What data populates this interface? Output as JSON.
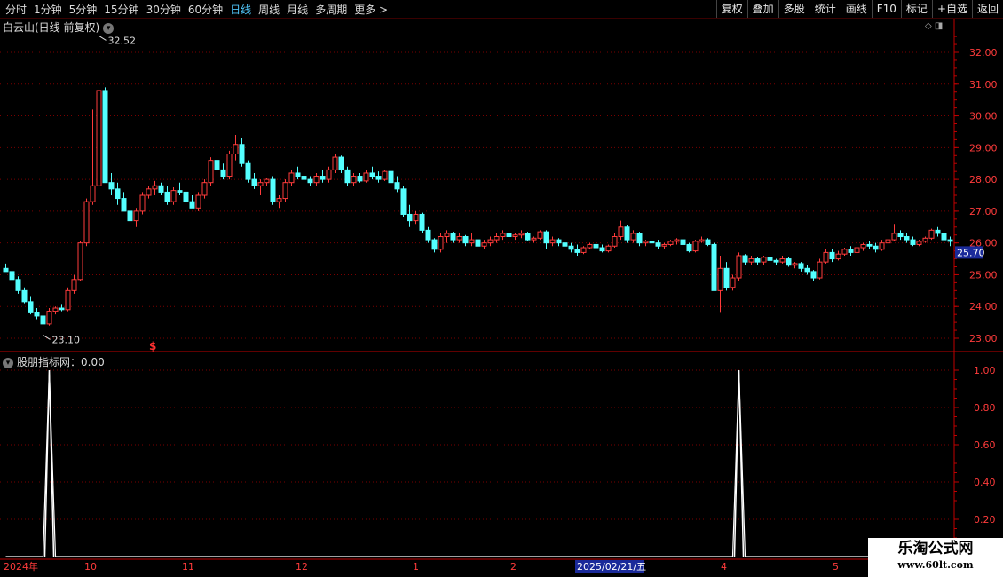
{
  "toolbar": {
    "periods": [
      "分时",
      "1分钟",
      "5分钟",
      "15分钟",
      "30分钟",
      "60分钟",
      "日线",
      "周线",
      "月线",
      "多周期",
      "更多 >"
    ],
    "active_period": "日线",
    "tools": [
      "复权",
      "叠加",
      "多股",
      "统计",
      "画线",
      "F10",
      "标记",
      "+自选",
      "返回"
    ]
  },
  "main_chart": {
    "title": "白云山(日线 前复权)",
    "dropdown_icon": "chevron-down-icon",
    "high_label": "32.52",
    "low_label": "23.10",
    "current_price": "25.70",
    "y_ticks": [
      "32.00",
      "31.00",
      "30.00",
      "29.00",
      "28.00",
      "27.00",
      "26.00",
      "25.00",
      "24.00",
      "23.00"
    ],
    "marker": "$"
  },
  "indicator": {
    "title": "股朋指标网：0.00",
    "y_ticks": [
      "1.00",
      "0.80",
      "0.60",
      "0.40",
      "0.20"
    ]
  },
  "x_axis": {
    "labels": [
      "2024年",
      "10",
      "11",
      "12",
      "1",
      "2",
      "4",
      "5"
    ],
    "highlight": "2025/02/21/五"
  },
  "watermark": {
    "line1": "乐淘公式网",
    "line2": "www.60lt.com"
  },
  "colors": {
    "up": "#ff3b3b",
    "down": "#54ffff",
    "grid": "#7a0000",
    "axis": "#c00000",
    "active": "#4fc3f7"
  },
  "chart_data": {
    "type": "candlestick",
    "series": [
      {
        "points": [
          [
            25.2,
            25.35,
            25.1,
            25.1
          ],
          [
            25.1,
            25.15,
            24.7,
            24.85
          ],
          [
            24.85,
            24.95,
            24.4,
            24.5
          ],
          [
            24.5,
            24.6,
            24.1,
            24.15
          ],
          [
            24.15,
            24.3,
            23.75,
            23.8
          ],
          [
            23.8,
            23.95,
            23.6,
            23.7
          ],
          [
            23.7,
            23.8,
            23.1,
            23.45
          ],
          [
            23.45,
            23.95,
            23.4,
            23.85
          ],
          [
            23.85,
            24.0,
            23.75,
            23.95
          ],
          [
            23.95,
            24.05,
            23.85,
            23.9
          ],
          [
            23.9,
            24.6,
            23.85,
            24.5
          ],
          [
            24.5,
            25.0,
            24.4,
            24.85
          ],
          [
            24.85,
            26.05,
            24.8,
            26.0
          ],
          [
            26.0,
            27.4,
            25.9,
            27.3
          ],
          [
            27.3,
            30.2,
            27.2,
            27.8
          ],
          [
            27.8,
            32.52,
            27.7,
            30.8
          ],
          [
            30.8,
            30.9,
            28.0,
            27.9
          ],
          [
            27.9,
            28.2,
            27.5,
            27.7
          ],
          [
            27.7,
            27.9,
            27.2,
            27.4
          ],
          [
            27.4,
            27.6,
            27.0,
            27.0
          ],
          [
            27.0,
            27.1,
            26.6,
            26.7
          ],
          [
            26.7,
            27.1,
            26.5,
            27.0
          ],
          [
            27.0,
            27.6,
            26.9,
            27.5
          ],
          [
            27.5,
            27.8,
            27.4,
            27.7
          ],
          [
            27.7,
            27.95,
            27.5,
            27.8
          ],
          [
            27.8,
            27.9,
            27.5,
            27.6
          ],
          [
            27.6,
            27.8,
            27.2,
            27.3
          ],
          [
            27.3,
            27.75,
            27.2,
            27.65
          ],
          [
            27.65,
            27.9,
            27.5,
            27.6
          ],
          [
            27.6,
            27.7,
            27.2,
            27.3
          ],
          [
            27.3,
            27.5,
            27.1,
            27.1
          ],
          [
            27.1,
            27.6,
            27.0,
            27.5
          ],
          [
            27.5,
            28.0,
            27.4,
            27.9
          ],
          [
            27.9,
            28.7,
            27.8,
            28.6
          ],
          [
            28.6,
            29.2,
            28.2,
            28.3
          ],
          [
            28.3,
            28.5,
            28.0,
            28.1
          ],
          [
            28.1,
            28.9,
            28.0,
            28.8
          ],
          [
            28.8,
            29.4,
            28.6,
            29.1
          ],
          [
            29.1,
            29.3,
            28.4,
            28.5
          ],
          [
            28.5,
            28.6,
            27.9,
            28.0
          ],
          [
            28.0,
            28.2,
            27.7,
            27.8
          ],
          [
            27.8,
            28.0,
            27.5,
            27.9
          ],
          [
            27.9,
            28.05,
            27.8,
            28.0
          ],
          [
            28.0,
            28.1,
            27.2,
            27.3
          ],
          [
            27.3,
            27.5,
            27.1,
            27.4
          ],
          [
            27.4,
            28.0,
            27.3,
            27.9
          ],
          [
            27.9,
            28.3,
            27.8,
            28.2
          ],
          [
            28.2,
            28.4,
            28.0,
            28.1
          ],
          [
            28.1,
            28.3,
            27.9,
            28.0
          ],
          [
            28.0,
            28.1,
            27.8,
            27.9
          ],
          [
            27.9,
            28.2,
            27.8,
            28.1
          ],
          [
            28.1,
            28.3,
            27.9,
            28.0
          ],
          [
            28.0,
            28.4,
            27.9,
            28.3
          ],
          [
            28.3,
            28.8,
            28.2,
            28.7
          ],
          [
            28.7,
            28.75,
            28.2,
            28.3
          ],
          [
            28.3,
            28.4,
            27.8,
            27.9
          ],
          [
            27.9,
            28.2,
            27.8,
            28.1
          ],
          [
            28.1,
            28.2,
            27.9,
            27.95
          ],
          [
            27.95,
            28.3,
            27.9,
            28.2
          ],
          [
            28.2,
            28.4,
            28.0,
            28.1
          ],
          [
            28.1,
            28.25,
            27.9,
            28.0
          ],
          [
            28.0,
            28.3,
            27.95,
            28.25
          ],
          [
            28.25,
            28.3,
            27.8,
            27.9
          ],
          [
            27.9,
            28.1,
            27.6,
            27.7
          ],
          [
            27.7,
            27.8,
            26.8,
            26.9
          ],
          [
            26.9,
            27.2,
            26.5,
            26.7
          ],
          [
            26.7,
            27.0,
            26.6,
            26.9
          ],
          [
            26.9,
            26.95,
            26.3,
            26.4
          ],
          [
            26.4,
            26.5,
            26.0,
            26.1
          ],
          [
            26.1,
            26.15,
            25.7,
            25.8
          ],
          [
            25.8,
            26.3,
            25.7,
            26.2
          ],
          [
            26.2,
            26.4,
            26.0,
            26.3
          ],
          [
            26.3,
            26.35,
            26.0,
            26.1
          ],
          [
            26.1,
            26.3,
            26.0,
            26.2
          ],
          [
            26.2,
            26.25,
            25.9,
            26.0
          ],
          [
            26.0,
            26.3,
            25.9,
            26.1
          ],
          [
            26.1,
            26.2,
            25.8,
            25.9
          ],
          [
            25.9,
            26.1,
            25.8,
            26.0
          ],
          [
            26.0,
            26.2,
            25.9,
            26.1
          ],
          [
            26.1,
            26.3,
            26.0,
            26.2
          ],
          [
            26.2,
            26.4,
            26.1,
            26.3
          ],
          [
            26.3,
            26.35,
            26.1,
            26.2
          ],
          [
            26.2,
            26.3,
            26.1,
            26.25
          ],
          [
            26.25,
            26.4,
            26.15,
            26.3
          ],
          [
            26.3,
            26.35,
            26.05,
            26.1
          ],
          [
            26.1,
            26.2,
            26.0,
            26.15
          ],
          [
            26.15,
            26.4,
            26.1,
            26.35
          ],
          [
            26.35,
            26.4,
            25.8,
            26.0
          ],
          [
            26.0,
            26.2,
            25.9,
            26.1
          ],
          [
            26.1,
            26.15,
            25.9,
            26.0
          ],
          [
            26.0,
            26.1,
            25.8,
            25.9
          ],
          [
            25.9,
            26.0,
            25.7,
            25.8
          ],
          [
            25.8,
            25.95,
            25.6,
            25.7
          ],
          [
            25.7,
            25.9,
            25.65,
            25.85
          ],
          [
            25.85,
            26.0,
            25.8,
            25.95
          ],
          [
            25.95,
            26.1,
            25.8,
            25.85
          ],
          [
            25.85,
            25.95,
            25.7,
            25.75
          ],
          [
            25.75,
            25.95,
            25.7,
            25.9
          ],
          [
            25.9,
            26.3,
            25.85,
            26.2
          ],
          [
            26.2,
            26.7,
            26.1,
            26.5
          ],
          [
            26.5,
            26.55,
            26.0,
            26.1
          ],
          [
            26.1,
            26.4,
            26.0,
            26.3
          ],
          [
            26.3,
            26.35,
            25.9,
            26.0
          ],
          [
            26.0,
            26.1,
            25.9,
            26.05
          ],
          [
            26.05,
            26.15,
            25.9,
            26.0
          ],
          [
            26.0,
            26.1,
            25.8,
            25.9
          ],
          [
            25.9,
            26.0,
            25.8,
            25.95
          ],
          [
            25.95,
            26.1,
            25.9,
            26.05
          ],
          [
            26.05,
            26.15,
            25.95,
            26.1
          ],
          [
            26.1,
            26.2,
            25.9,
            25.95
          ],
          [
            25.95,
            26.0,
            25.7,
            25.75
          ],
          [
            25.75,
            26.1,
            25.7,
            26.05
          ],
          [
            26.05,
            26.2,
            26.0,
            26.1
          ],
          [
            26.1,
            26.15,
            25.9,
            25.95
          ],
          [
            25.95,
            26.0,
            24.5,
            24.5
          ],
          [
            24.5,
            25.6,
            23.8,
            25.2
          ],
          [
            25.2,
            25.4,
            24.5,
            24.6
          ],
          [
            24.6,
            25.0,
            24.5,
            24.9
          ],
          [
            24.9,
            25.7,
            24.8,
            25.6
          ],
          [
            25.6,
            25.65,
            25.3,
            25.4
          ],
          [
            25.4,
            25.6,
            25.3,
            25.5
          ],
          [
            25.5,
            25.55,
            25.3,
            25.4
          ],
          [
            25.4,
            25.6,
            25.3,
            25.55
          ],
          [
            25.55,
            25.6,
            25.35,
            25.45
          ],
          [
            25.45,
            25.5,
            25.3,
            25.4
          ],
          [
            25.4,
            25.6,
            25.35,
            25.5
          ],
          [
            25.5,
            25.55,
            25.25,
            25.3
          ],
          [
            25.3,
            25.4,
            25.2,
            25.35
          ],
          [
            25.35,
            25.4,
            25.1,
            25.2
          ],
          [
            25.2,
            25.3,
            25.0,
            25.1
          ],
          [
            25.1,
            25.15,
            24.8,
            24.9
          ],
          [
            24.9,
            25.5,
            24.85,
            25.4
          ],
          [
            25.4,
            25.8,
            25.35,
            25.7
          ],
          [
            25.7,
            25.8,
            25.4,
            25.5
          ],
          [
            25.5,
            25.75,
            25.45,
            25.65
          ],
          [
            25.65,
            25.85,
            25.6,
            25.8
          ],
          [
            25.8,
            25.9,
            25.6,
            25.7
          ],
          [
            25.7,
            25.9,
            25.65,
            25.85
          ],
          [
            25.85,
            26.0,
            25.75,
            25.95
          ],
          [
            25.95,
            26.05,
            25.8,
            25.9
          ],
          [
            25.9,
            26.0,
            25.7,
            25.8
          ],
          [
            25.8,
            26.1,
            25.75,
            26.0
          ],
          [
            26.0,
            26.2,
            25.95,
            26.1
          ],
          [
            26.1,
            26.6,
            26.05,
            26.3
          ],
          [
            26.3,
            26.4,
            26.1,
            26.2
          ],
          [
            26.2,
            26.3,
            26.0,
            26.1
          ],
          [
            26.1,
            26.2,
            25.9,
            25.95
          ],
          [
            25.95,
            26.1,
            25.9,
            26.05
          ],
          [
            26.05,
            26.2,
            26.0,
            26.15
          ],
          [
            26.15,
            26.45,
            26.1,
            26.4
          ],
          [
            26.4,
            26.5,
            26.2,
            26.3
          ],
          [
            26.3,
            26.35,
            26.0,
            26.1
          ],
          [
            26.1,
            26.2,
            25.9,
            26.05
          ]
        ]
      },
      {
        "name": "股朋指标网",
        "values": [
          0,
          0,
          0,
          0,
          0,
          0,
          0,
          0,
          0,
          0,
          0,
          0,
          0,
          0,
          0,
          0,
          0,
          0,
          0,
          0,
          0,
          0,
          0,
          0,
          0,
          0,
          0,
          0,
          0,
          0,
          0,
          0,
          0,
          0,
          0,
          0,
          0,
          0,
          0,
          0,
          0,
          0,
          0,
          0,
          0,
          0,
          0,
          0,
          0,
          0,
          0,
          0,
          0,
          0,
          0,
          0,
          0,
          0,
          0,
          0,
          0,
          0,
          0,
          0,
          0,
          0,
          0,
          0,
          0,
          0,
          0,
          0,
          0,
          0,
          0,
          0,
          0,
          0,
          0,
          0,
          0,
          0,
          0,
          0,
          0,
          0,
          0,
          0,
          0,
          0,
          0,
          0,
          0,
          0,
          0,
          0,
          0,
          0,
          0,
          0,
          0,
          0,
          0,
          0,
          0,
          0,
          0,
          0,
          0,
          0,
          0,
          0,
          0,
          0,
          0,
          0,
          0,
          0,
          0,
          0,
          0,
          0,
          0,
          0,
          0,
          0,
          0,
          0,
          0,
          0,
          0,
          0,
          0,
          0,
          0,
          0,
          0,
          0,
          0,
          0,
          0,
          0,
          0,
          0,
          0,
          0,
          0,
          0,
          0,
          0,
          0,
          0,
          0,
          0,
          0,
          0,
          0
        ]
      }
    ],
    "spikes_at": [
      7,
      118
    ],
    "ylim": [
      22.7,
      33.0
    ],
    "indicator_ylim": [
      0,
      1.05
    ],
    "grid": true
  }
}
